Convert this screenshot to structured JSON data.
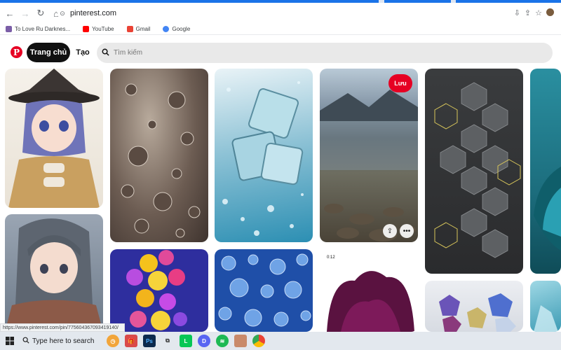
{
  "browser": {
    "url": "pinterest.com",
    "status_url": "https://www.pinterest.com/pin/775604367093419140/",
    "bookmarks": [
      {
        "label": "To Love Ru Darknes...",
        "icon": "to-love-ru-favicon",
        "color": "#7b5ea7"
      },
      {
        "label": "YouTube",
        "icon": "youtube-icon",
        "color": "#ff0000"
      },
      {
        "label": "Gmail",
        "icon": "gmail-icon",
        "color": "#ea4335"
      },
      {
        "label": "Google",
        "icon": "google-icon",
        "color": "#4285f4"
      }
    ]
  },
  "header": {
    "logo": "P",
    "home_label": "Trang chủ",
    "create_label": "Tạo",
    "search_placeholder": "Tìm kiếm",
    "accent": "#e60023"
  },
  "pins": [
    {
      "name": "pin-anime-witch",
      "desc": "anime girl in witch hat"
    },
    {
      "name": "pin-anime-girl-gray",
      "desc": "anime girl with gray hair"
    },
    {
      "name": "pin-water-drops",
      "desc": "water droplets"
    },
    {
      "name": "pin-candy-balls",
      "desc": "colorful balls"
    },
    {
      "name": "pin-ice-cubes",
      "desc": "ice cubes in water"
    },
    {
      "name": "pin-blue-bubbles",
      "desc": "blue water bubbles"
    },
    {
      "name": "pin-lake-stones",
      "desc": "mountain lake with stones",
      "save_label": "Lưu"
    },
    {
      "name": "pin-purple-ink",
      "desc": "purple ink in water",
      "duration": "0:12"
    },
    {
      "name": "pin-hexagons",
      "desc": "gray hexagon pattern"
    },
    {
      "name": "pin-gemstones",
      "desc": "gemstones"
    },
    {
      "name": "pin-teal-leaf",
      "desc": "teal leaves"
    },
    {
      "name": "pin-teal-crystal",
      "desc": "teal crystals"
    }
  ],
  "taskbar": {
    "search_placeholder": "Type here to search",
    "apps": [
      "clock-icon",
      "gift-icon",
      "photoshop-icon",
      "multitask-icon",
      "line-icon",
      "discord-icon",
      "spotify-icon",
      "photo-icon",
      "chrome-icon"
    ]
  }
}
